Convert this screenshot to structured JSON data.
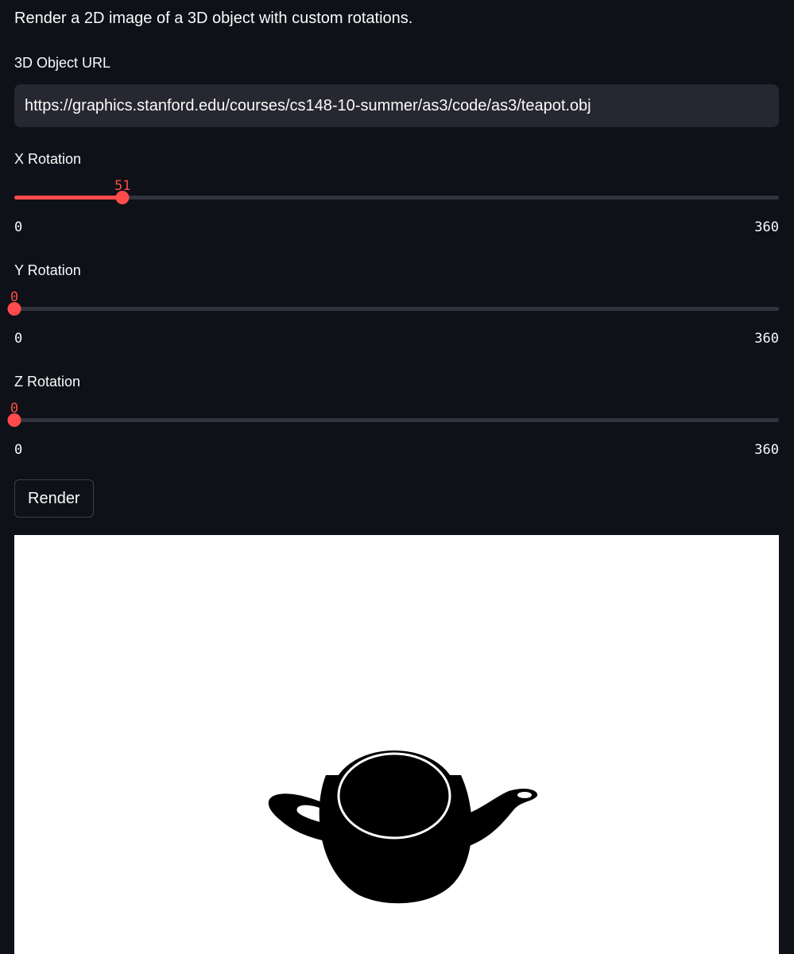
{
  "description": "Render a 2D image of a 3D object with custom rotations.",
  "url_field": {
    "label": "3D Object URL",
    "value": "https://graphics.stanford.edu/courses/cs148-10-summer/as3/code/as3/teapot.obj"
  },
  "sliders": [
    {
      "label": "X Rotation",
      "value": "51",
      "min": "0",
      "max": "360"
    },
    {
      "label": "Y Rotation",
      "value": "0",
      "min": "0",
      "max": "360"
    },
    {
      "label": "Z Rotation",
      "value": "0",
      "min": "0",
      "max": "360"
    }
  ],
  "render_button": {
    "label": "Render"
  },
  "output_image": {
    "subject": "teapot-silhouette",
    "background": "#ffffff",
    "fill": "#000000"
  },
  "colors": {
    "background": "#0e1117",
    "accent": "#ff4b4b",
    "input_background": "#262730",
    "track": "#31333f",
    "text": "#fafafa"
  }
}
